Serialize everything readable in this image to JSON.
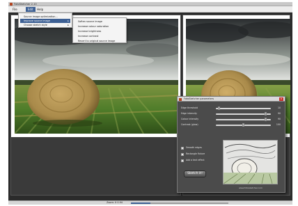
{
  "window": {
    "title": "FotoSketcher 2.10"
  },
  "menubar": {
    "items": [
      "File",
      "Edit",
      "Help"
    ],
    "active_item": "Edit"
  },
  "edit_menu": {
    "items": [
      {
        "label": "Source image optimization...",
        "has_submenu": false
      },
      {
        "label": "Improve source image",
        "has_submenu": true
      },
      {
        "label": "Choose sketch style",
        "has_submenu": true
      }
    ],
    "highlighted": "Improve source image"
  },
  "improve_submenu": {
    "items": [
      "Soften source image",
      "Increase colour saturation",
      "Increase brightness",
      "Increase contrast",
      "Revert to original source image"
    ]
  },
  "sketch_panel": {
    "title": "FotoSketcher parameters",
    "sliders": [
      {
        "label": "Edge threshold",
        "value": "10",
        "level": 0.06
      },
      {
        "label": "Edge intensity",
        "value": "90",
        "level": 0.9
      },
      {
        "label": "Colour intensity",
        "value": "90",
        "level": 0.9
      },
      {
        "label": "Contrast (glow)",
        "value": "100",
        "level": 0.5
      }
    ],
    "checkboxes": [
      {
        "label": "Smooth edges",
        "checked": false
      },
      {
        "label": "Rectangle fixture",
        "checked": false
      },
      {
        "label": "Add a text effect",
        "checked": false
      }
    ],
    "sketch_button": "Sketch it!",
    "website": "www.fotosketcher.com"
  },
  "statusbar": {
    "zoom_label": "Zoom: X 0.94",
    "zoom_level": 0.2
  },
  "colors": {
    "accent": "#3c5f93",
    "workspace": "#2b2b2b",
    "panel": "#4b4b4b",
    "close": "#c9302c",
    "sky_dark": "#2f3336",
    "sky_light": "#eef0ee",
    "field_green": "#4f7d2a",
    "hay": "#a98a4a"
  },
  "icons": [
    "app-icon",
    "submenu-arrow-icon",
    "close-icon"
  ]
}
